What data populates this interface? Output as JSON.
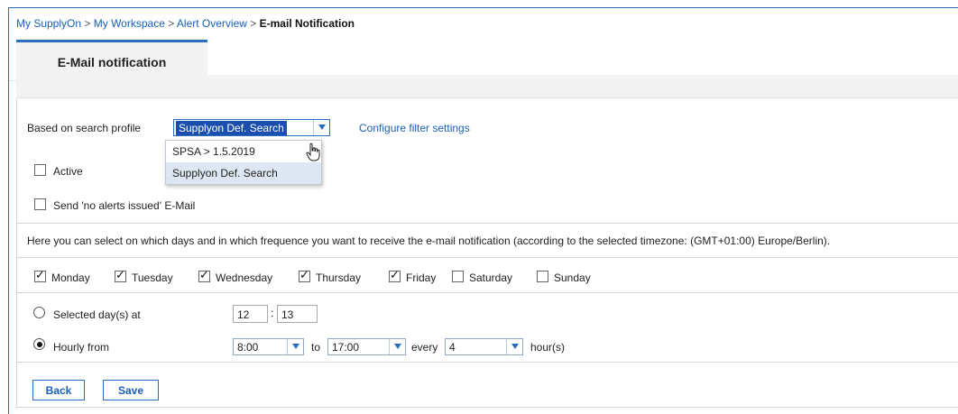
{
  "breadcrumb": {
    "items": [
      "My SupplyOn",
      "My Workspace",
      "Alert Overview"
    ],
    "separator": ">",
    "current": "E-mail Notification"
  },
  "tab": {
    "label": "E-Mail notification"
  },
  "profile": {
    "label": "Based on search profile",
    "selected": "Supplyon Def. Search",
    "options": [
      "SPSA > 1.5.2019",
      "Supplyon Def. Search"
    ],
    "configure_link": "Configure filter settings"
  },
  "active": {
    "label": "Active",
    "checked": false
  },
  "no_alerts": {
    "label": "Send 'no alerts issued' E-Mail",
    "checked": false
  },
  "info_text": "Here you can select on which days and in which frequence you want to receive the e-mail notification (according to the selected timezone: (GMT+01:00) Europe/Berlin).",
  "days": [
    {
      "label": "Monday",
      "checked": true
    },
    {
      "label": "Tuesday",
      "checked": true
    },
    {
      "label": "Wednesday",
      "checked": true
    },
    {
      "label": "Thursday",
      "checked": true
    },
    {
      "label": "Friday",
      "checked": true
    },
    {
      "label": "Saturday",
      "checked": false
    },
    {
      "label": "Sunday",
      "checked": false
    }
  ],
  "schedule": {
    "selected_days": {
      "label": "Selected day(s) at",
      "hour": "12",
      "colon": ":",
      "minute": "13",
      "checked": false
    },
    "hourly": {
      "label": "Hourly from",
      "from": "8:00",
      "to_label": "to",
      "to": "17:00",
      "every_label": "every",
      "every": "4",
      "unit": "hour(s)",
      "checked": true
    }
  },
  "buttons": {
    "back": "Back",
    "save": "Save"
  },
  "colors": {
    "accent": "#2a6ebb",
    "link": "#1a5fb4",
    "selected_bg": "#1a4fb0"
  }
}
